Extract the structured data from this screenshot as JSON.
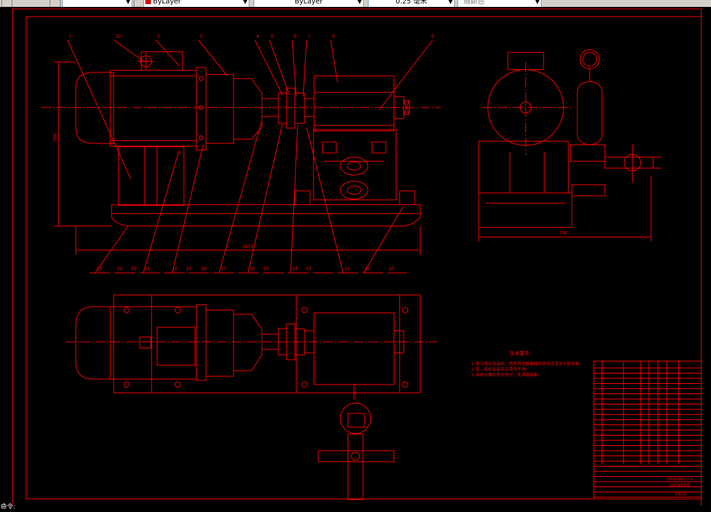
{
  "toolbar": {
    "style_combo_value": "",
    "color_combo_value": "ByLayer",
    "linetype_combo_value": "ByLayer",
    "lineweight_combo_value": "0.25 毫米",
    "plotstyle_combo_value": "随颜色"
  },
  "colors": {
    "background": "#000000",
    "drawing": "#ff0000",
    "toolbar": "#d4d0c8"
  },
  "drawing": {
    "balloons_top": [
      "1",
      "22",
      "2",
      "3",
      "4",
      "5",
      "6",
      "7",
      "8",
      "9"
    ],
    "balloons_bottom": [
      "23",
      "21",
      "20",
      "19",
      "11",
      "10",
      "18",
      "17",
      "16",
      "15",
      "14",
      "13",
      "12",
      "11",
      "10"
    ],
    "dim_overall_length": "1470",
    "dim_height": "560",
    "dim_width": "790",
    "notes_title": "技术要求",
    "notes_items": [
      "1. 泵与电机安装后，用手转动联轴器应转动灵活无卡阻现象。",
      "2. 泵、电机安装前应清洗干净。",
      "3. 各密封面应密封良好，无泄漏现象。"
    ],
    "title_block": {
      "drawing_no": "2WCB-160/1.0-Ⅱ",
      "drawing_name": "齿轮油泵机组",
      "code": "NJB-00"
    }
  },
  "statusbar": {
    "prompt": "命令:"
  }
}
